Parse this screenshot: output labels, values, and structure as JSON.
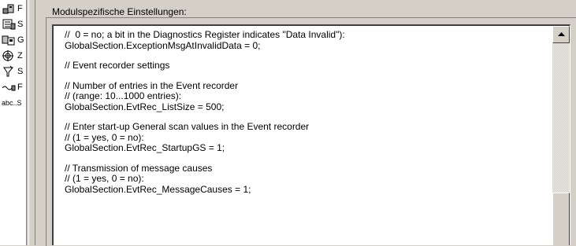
{
  "tree": {
    "items": [
      {
        "icon": "module-icon",
        "label": "F"
      },
      {
        "icon": "settings-icon",
        "label": "S"
      },
      {
        "icon": "group-icon",
        "label": "G"
      },
      {
        "icon": "target-icon",
        "label": "Z"
      },
      {
        "icon": "funnel-icon",
        "label": "S"
      },
      {
        "icon": "link-icon",
        "label": "F"
      },
      {
        "icon": "text-icon",
        "label": "abc..S"
      }
    ]
  },
  "section": {
    "title": "Modulspezifische Einstellungen:"
  },
  "editor": {
    "lines": [
      "//  0 = no; a bit in the Diagnostics Register indicates \"Data Invalid\"):",
      "GlobalSection.ExceptionMsgAtInvalidData = 0;",
      "",
      "// Event recorder settings",
      "",
      "// Number of entries in the Event recorder",
      "// (range: 10...1000 entries):",
      "GlobalSection.EvtRec_ListSize = 500;",
      "",
      "// Enter start-up General scan values in the Event recorder",
      "// (1 = yes, 0 = no):",
      "GlobalSection.EvtRec_StartupGS = 1;",
      "",
      "// Transmission of message causes",
      "// (1 = yes, 0 = no):",
      "GlobalSection.EvtRec_MessageCauses = 1;"
    ],
    "scroll_position": 0.85
  },
  "colors": {
    "window_bg": "#d4d0c8",
    "editor_bg": "#ffffff"
  }
}
